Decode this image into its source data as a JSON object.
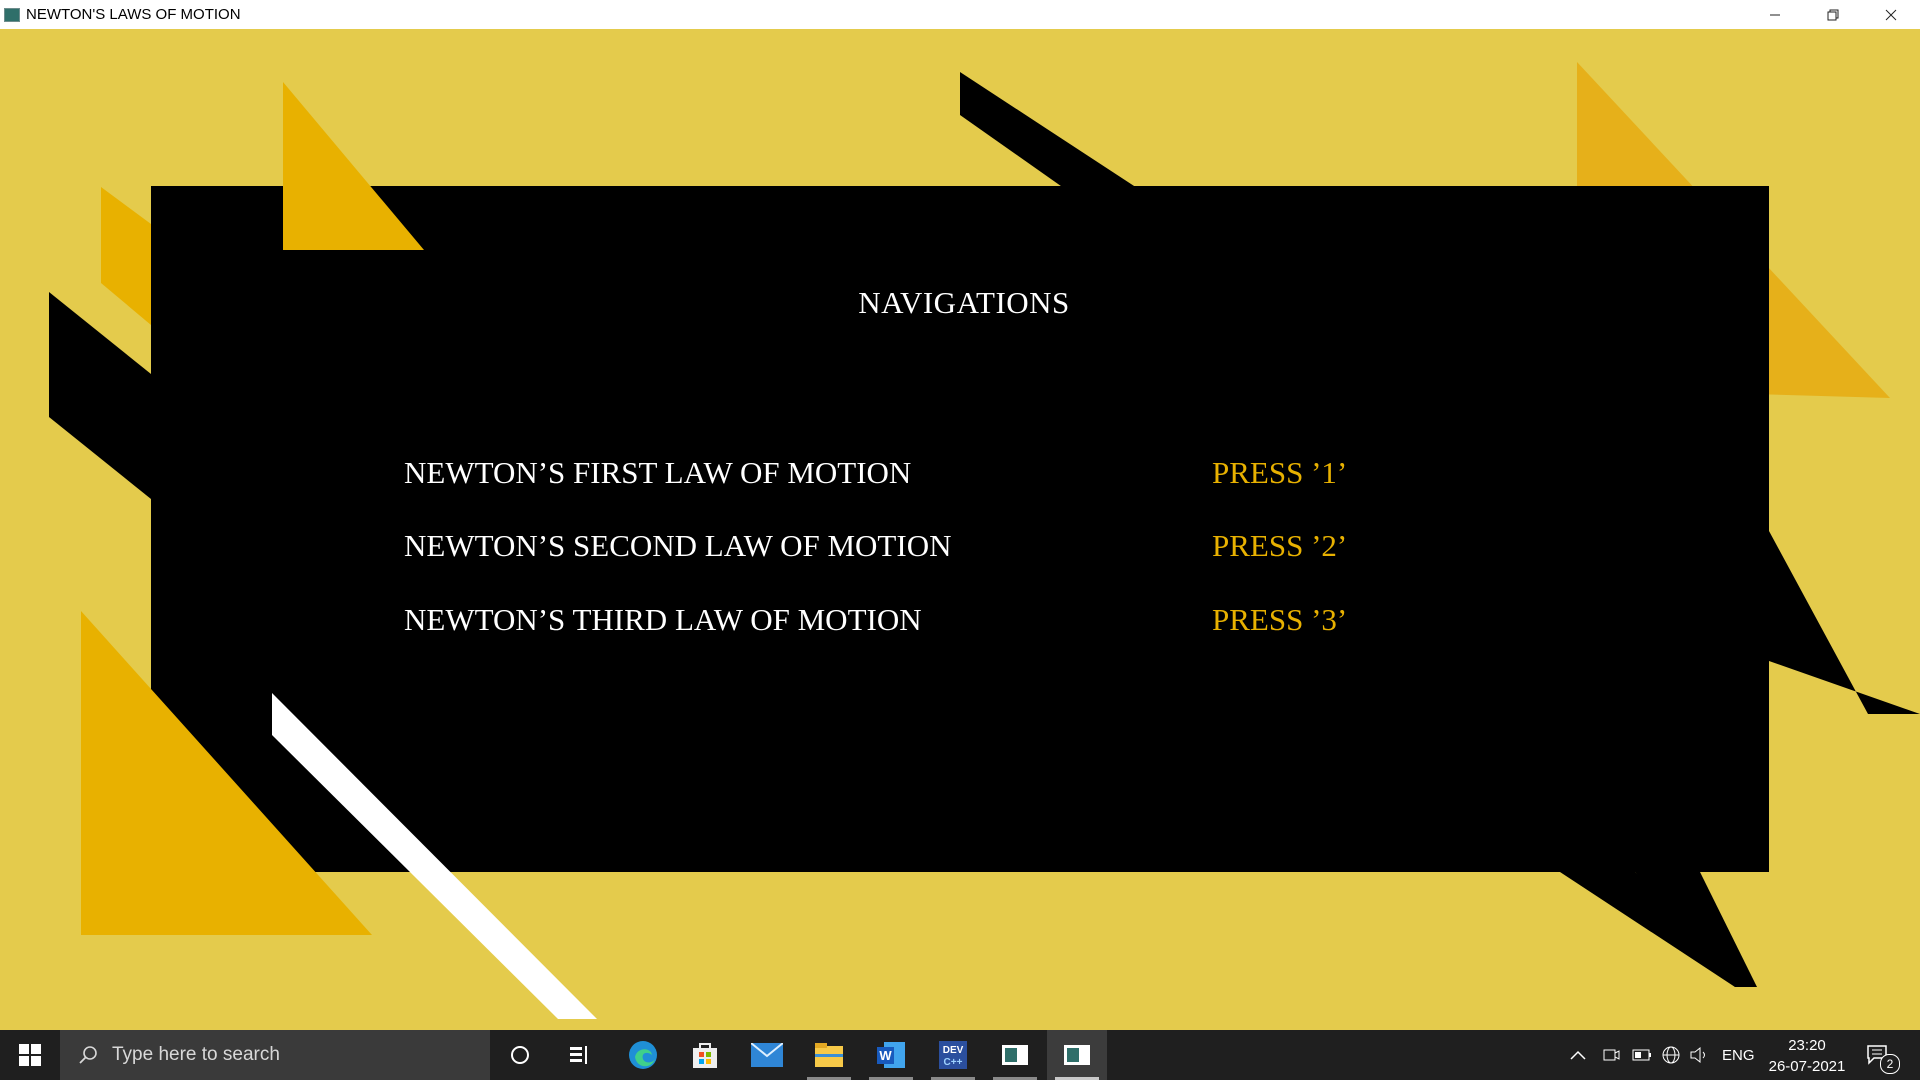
{
  "window": {
    "title": "NEWTON'S LAWS OF MOTION",
    "minimize_icon": "minimize-icon",
    "restore_icon": "restore-icon",
    "close_icon": "close-icon"
  },
  "content": {
    "heading": "NAVIGATIONS",
    "items": [
      {
        "label": "NEWTON’S FIRST LAW OF MOTION",
        "key": "PRESS ’1’"
      },
      {
        "label": "NEWTON’S SECOND LAW OF MOTION",
        "key": "PRESS ’2’"
      },
      {
        "label": "NEWTON’S THIRD LAW OF MOTION",
        "key": "PRESS ’3’"
      }
    ]
  },
  "colors": {
    "background": "#e4cb4c",
    "panel": "#000000",
    "accent": "#e8b100",
    "text": "#ffffff"
  },
  "taskbar": {
    "search_placeholder": "Type here to search",
    "apps": [
      "cortana-icon",
      "task-view-icon",
      "edge-icon",
      "store-icon",
      "mail-icon",
      "file-explorer-icon",
      "word-icon",
      "devcpp-icon",
      "app-window-icon",
      "app-window-active-icon"
    ],
    "language": "ENG",
    "time": "23:20",
    "date": "26-07-2021",
    "notification_count": "2"
  }
}
